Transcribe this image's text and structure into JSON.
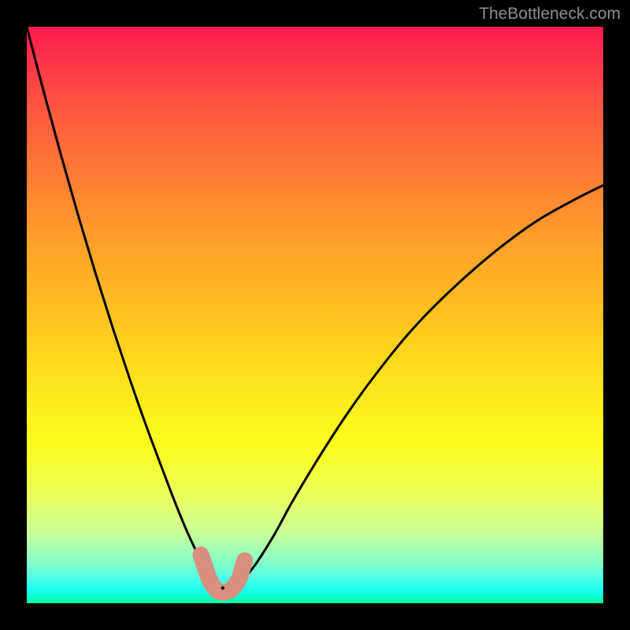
{
  "watermark": {
    "text": "TheBottleneck.com"
  },
  "colors": {
    "curve": "#000000",
    "marker": "#d98e7e",
    "markerStroke": "#b36b5b"
  },
  "chart_data": {
    "type": "line",
    "title": "",
    "xlabel": "",
    "ylabel": "",
    "xlim": [
      0,
      100
    ],
    "ylim": [
      0,
      100
    ],
    "grid": false,
    "series": [
      {
        "name": "bottleneck-curve",
        "x": [
          0,
          3,
          6,
          9,
          12,
          15,
          18,
          21,
          24,
          26,
          28,
          30,
          31,
          32,
          33,
          34,
          35,
          36,
          37,
          38,
          40,
          43,
          46,
          50,
          55,
          60,
          66,
          72,
          80,
          88,
          95,
          100
        ],
        "y": [
          100,
          88.5,
          77.5,
          67.0,
          57.0,
          47.5,
          38.5,
          30.0,
          22.0,
          16.8,
          12.0,
          7.8,
          6.0,
          4.6,
          3.6,
          3.0,
          2.7,
          3.0,
          3.6,
          4.6,
          7.2,
          12.0,
          17.5,
          24.2,
          32.0,
          39.0,
          46.5,
          52.8,
          60.0,
          66.0,
          70.0,
          72.5
        ]
      }
    ],
    "markers": [
      {
        "name": "left-marker-top",
        "x": 30.2,
        "y": 8.4
      },
      {
        "name": "left-marker-bottom",
        "x": 31.6,
        "y": 4.3
      },
      {
        "name": "right-marker-top",
        "x": 37.8,
        "y": 7.4
      },
      {
        "name": "right-marker-bottom",
        "x": 36.9,
        "y": 4.3
      },
      {
        "name": "min-marker",
        "x": 34.0,
        "y": 2.5
      }
    ],
    "marker_path_key": "u_shape"
  }
}
